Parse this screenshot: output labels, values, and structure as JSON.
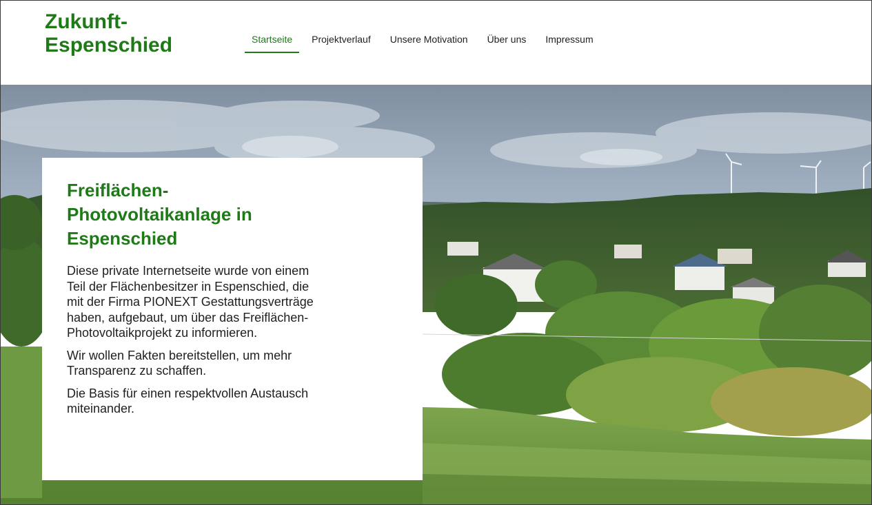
{
  "header": {
    "site_title": "Zukunft-\nEspenschied",
    "nav": [
      {
        "label": "Startseite",
        "active": true
      },
      {
        "label": "Projektverlauf",
        "active": false
      },
      {
        "label": "Unsere Motivation",
        "active": false
      },
      {
        "label": "Über uns",
        "active": false
      },
      {
        "label": "Impressum",
        "active": false
      }
    ]
  },
  "hero": {
    "title": "Freiflächen-Photovoltaikanlage in Espenschied",
    "paragraphs": [
      "Diese private Internetseite wurde von einem Teil der Flächenbesitzer in Espenschied, die mit der Firma PIONEXT Gestattungsverträge haben, aufgebaut, um über das Freiflächen-Photovoltaikprojekt zu informieren.",
      "Wir wollen Fakten bereitstellen, um mehr Transparenz zu schaffen.",
      "Die Basis für einen respektvollen Austausch miteinander."
    ]
  },
  "colors": {
    "accent": "#1e7a16",
    "text": "#1f1f1f",
    "card_bg": "#ffffff"
  }
}
